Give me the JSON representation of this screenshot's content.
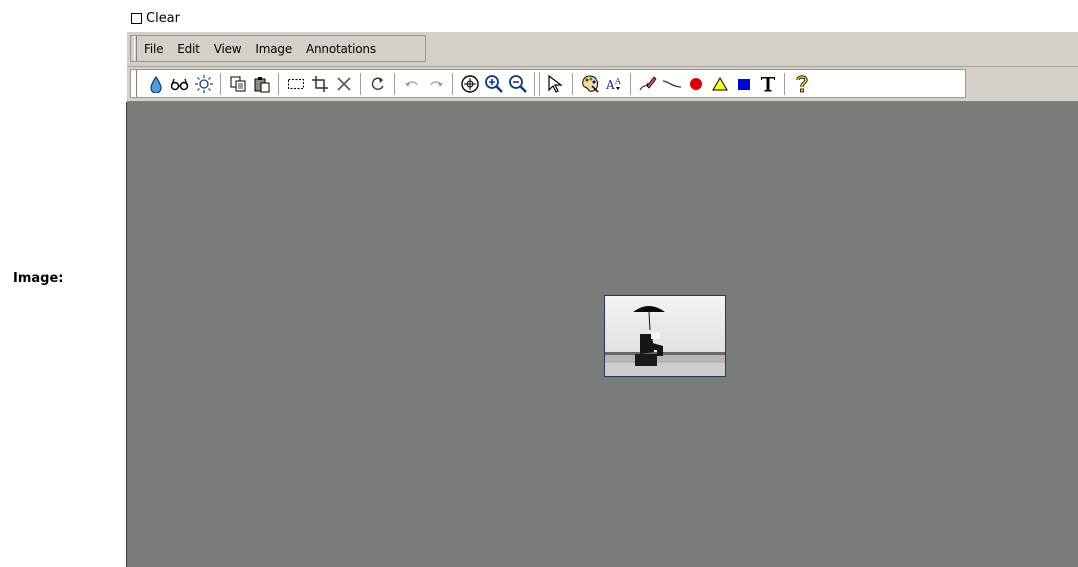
{
  "form": {
    "image_label": "Image:",
    "clear_label": "Clear",
    "clear_checked": false
  },
  "menubar": {
    "items": [
      "File",
      "Edit",
      "View",
      "Image",
      "Annotations"
    ]
  },
  "toolbar": {
    "tools": [
      "dropper-icon",
      "glasses-icon",
      "brightness-icon",
      "copy-icon",
      "paste-icon",
      "select-rect-icon",
      "crop-icon",
      "delete-icon",
      "rotate-icon",
      "undo-icon",
      "redo-icon",
      "zoom-fit-icon",
      "zoom-in-icon",
      "zoom-out-icon",
      "pointer-icon",
      "palette-icon",
      "font-size-icon",
      "pen-icon",
      "line-icon",
      "ellipse-icon",
      "triangle-icon",
      "rectangle-icon",
      "text-icon",
      "help-icon"
    ]
  },
  "colors": {
    "canvas_bg": "#7a7c78",
    "toolbar_bg": "#d4d0c8",
    "ellipse_red": "#e00000",
    "triangle_yellow": "#ffff00",
    "rect_blue": "#0000e0"
  }
}
